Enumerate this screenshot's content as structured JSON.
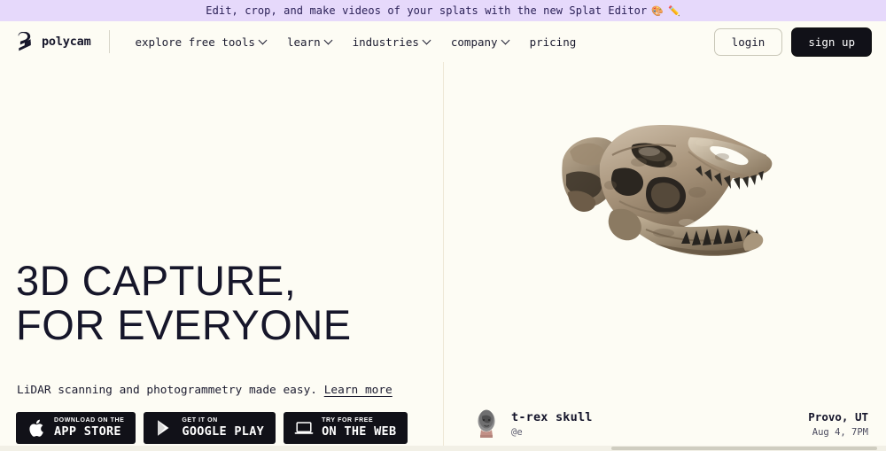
{
  "colors": {
    "page_bg": "#FDFCF4",
    "banner_bg": "#E6D9FB",
    "banner_text": "#2b2157",
    "ink": "#17172b",
    "dark_button": "#111118",
    "divider": "#eee8d6"
  },
  "banner": {
    "text": "Edit, crop, and make videos of your splats with the new Splat Editor",
    "emoji_palette": "🎨",
    "emoji_pen": "✏️"
  },
  "header": {
    "brand": "polycam",
    "brand_icon": "polycam-logo-icon",
    "nav": [
      {
        "label": "explore free tools",
        "has_chevron": true
      },
      {
        "label": "learn",
        "has_chevron": true
      },
      {
        "label": "industries",
        "has_chevron": true
      },
      {
        "label": "company",
        "has_chevron": true
      },
      {
        "label": "pricing",
        "has_chevron": false
      }
    ],
    "login_label": "login",
    "signup_label": "sign up"
  },
  "hero": {
    "headline_line1": "3D CAPTURE,",
    "headline_line2": "FOR EVERYONE",
    "subtitle": "LiDAR scanning and photogrammetry made easy.",
    "learn_more": "Learn more",
    "store_buttons": [
      {
        "icon": "apple-icon",
        "small": "DOWNLOAD ON THE",
        "big": "APP STORE"
      },
      {
        "icon": "google-play-icon",
        "small": "GET IT ON",
        "big": "GOOGLE PLAY"
      },
      {
        "icon": "laptop-icon",
        "small": "TRY FOR FREE",
        "big": "ON THE WEB"
      }
    ]
  },
  "capture": {
    "model_name": "t-rex-skull-3d-model",
    "title": "t-rex skull",
    "handle": "@e",
    "location": "Provo, UT",
    "date": "Aug 4, 7PM",
    "avatar_name": "user-avatar-head-scan"
  }
}
